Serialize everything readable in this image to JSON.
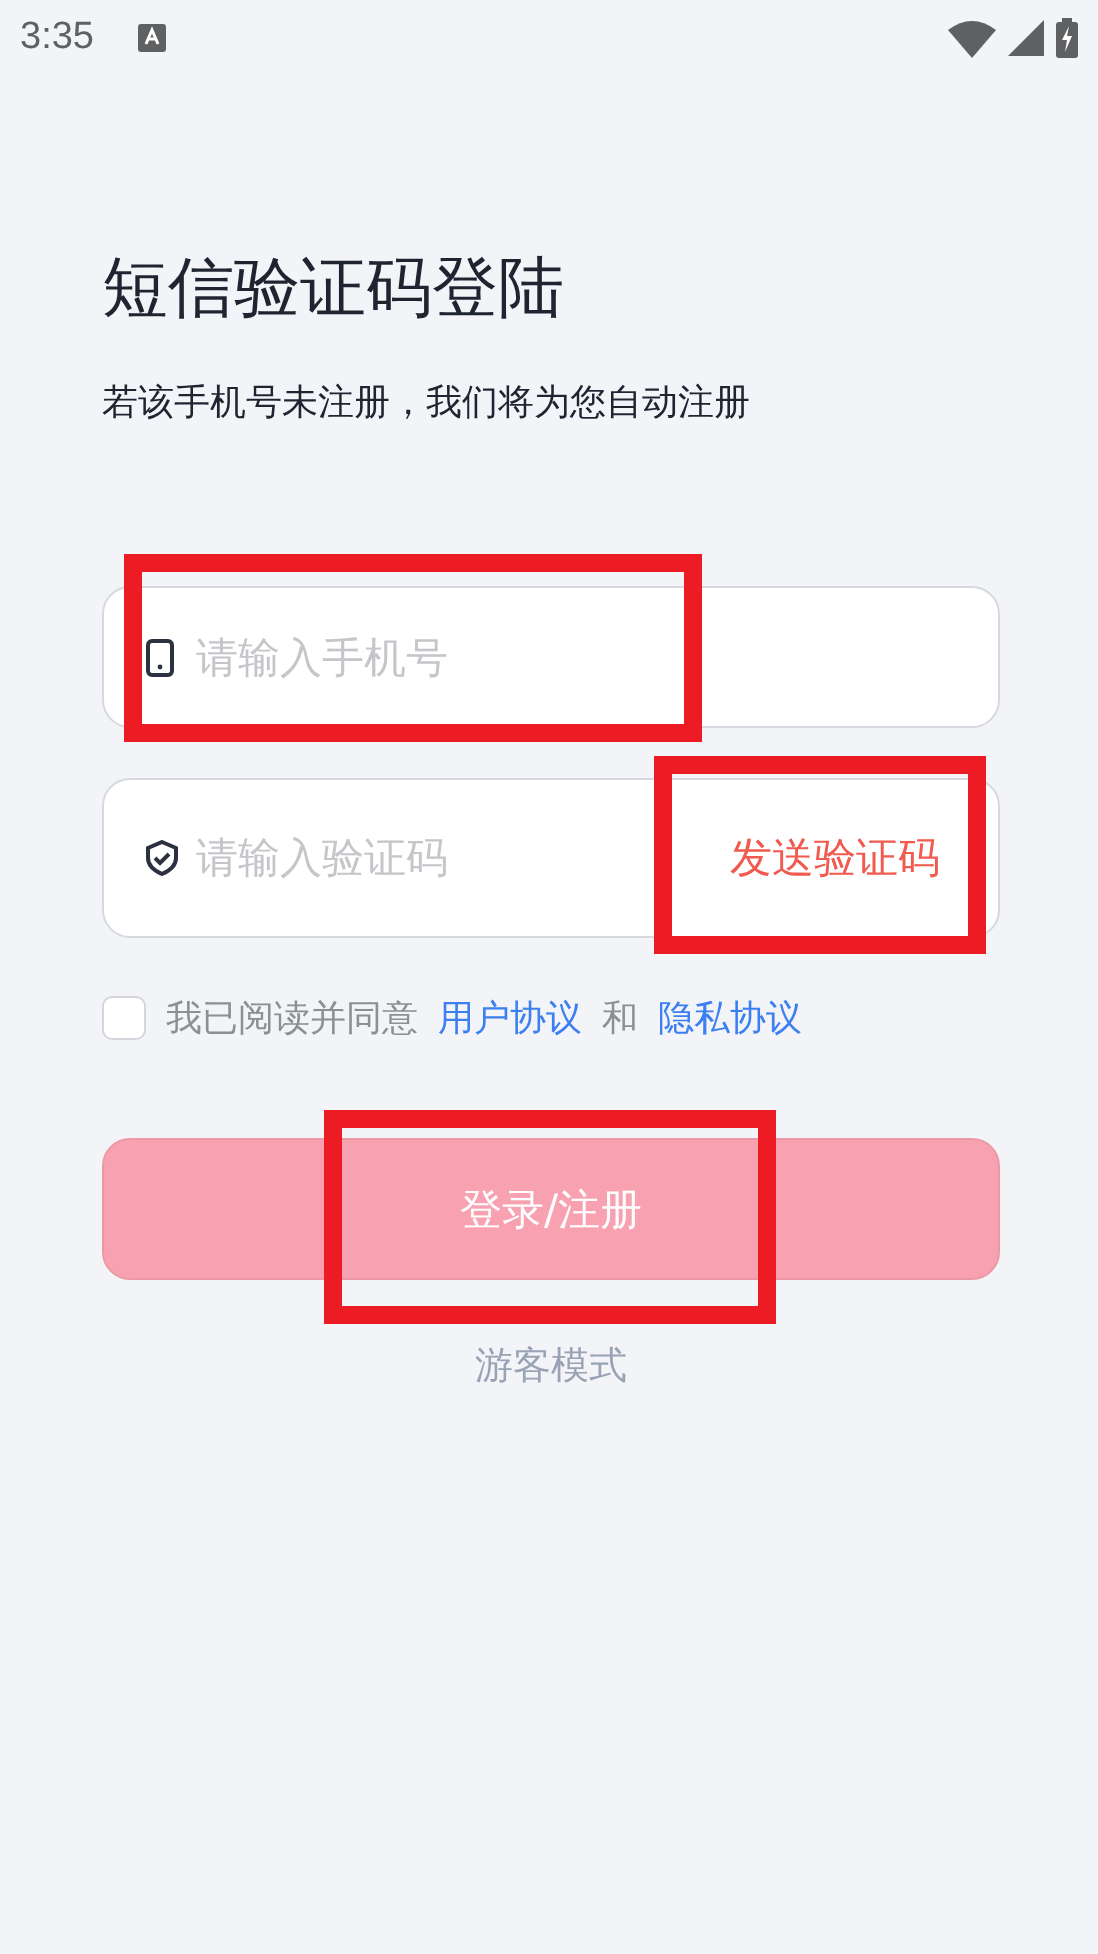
{
  "status_bar": {
    "time": "3:35"
  },
  "title": "短信验证码登陆",
  "subtitle": "若该手机号未注册，我们将为您自动注册",
  "phone_field": {
    "placeholder": "请输入手机号",
    "highlighted": true
  },
  "code_field": {
    "placeholder": "请输入验证码"
  },
  "send_code_button": {
    "label": "发送验证码",
    "highlighted": true
  },
  "agreement": {
    "checked": false,
    "text": "我已阅读并同意",
    "link_1": "用户协议",
    "conjunction": "和",
    "link_2": "隐私协议"
  },
  "login_button": {
    "label": "登录/注册",
    "highlighted": true
  },
  "guest_mode": "游客模式"
}
